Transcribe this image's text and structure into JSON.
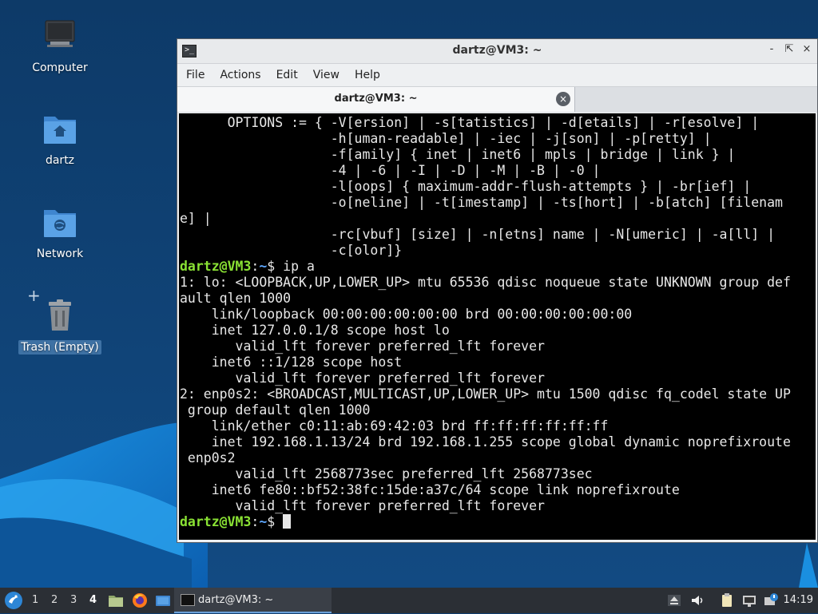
{
  "desktop": {
    "icons": [
      {
        "label": "Computer",
        "icon": "computer-icon"
      },
      {
        "label": "dartz",
        "icon": "home-folder-icon"
      },
      {
        "label": "Network",
        "icon": "network-folder-icon"
      },
      {
        "label": "Trash (Empty)",
        "icon": "trash-icon"
      }
    ],
    "plus": "+"
  },
  "window": {
    "title": "dartz@VM3: ~",
    "controls": {
      "minimize": "-",
      "restore": "⇱",
      "close": "×"
    },
    "menu": [
      "File",
      "Actions",
      "Edit",
      "View",
      "Help"
    ],
    "tab": {
      "label": "dartz@VM3: ~",
      "close": "×"
    }
  },
  "terminal": {
    "prompt_user": "dartz@VM3",
    "prompt_sep": ":",
    "prompt_path": "~",
    "prompt_sym": "$ ",
    "block1": "      OPTIONS := { -V[ersion] | -s[tatistics] | -d[etails] | -r[esolve] |\n                   -h[uman-readable] | -iec | -j[son] | -p[retty] |\n                   -f[amily] { inet | inet6 | mpls | bridge | link } |\n                   -4 | -6 | -I | -D | -M | -B | -0 |\n                   -l[oops] { maximum-addr-flush-attempts } | -br[ief] |\n                   -o[neline] | -t[imestamp] | -ts[hort] | -b[atch] [filenam\ne] |\n                   -rc[vbuf] [size] | -n[etns] name | -N[umeric] | -a[ll] |\n                   -c[olor]}",
    "command": "ip a",
    "block2": "1: lo: <LOOPBACK,UP,LOWER_UP> mtu 65536 qdisc noqueue state UNKNOWN group def\nault qlen 1000\n    link/loopback 00:00:00:00:00:00 brd 00:00:00:00:00:00\n    inet 127.0.0.1/8 scope host lo\n       valid_lft forever preferred_lft forever\n    inet6 ::1/128 scope host\n       valid_lft forever preferred_lft forever\n2: enp0s2: <BROADCAST,MULTICAST,UP,LOWER_UP> mtu 1500 qdisc fq_codel state UP\n group default qlen 1000\n    link/ether c0:11:ab:69:42:03 brd ff:ff:ff:ff:ff:ff\n    inet 192.168.1.13/24 brd 192.168.1.255 scope global dynamic noprefixroute\n enp0s2\n       valid_lft 2568773sec preferred_lft 2568773sec\n    inet6 fe80::bf52:38fc:15de:a37c/64 scope link noprefixroute\n       valid_lft forever preferred_lft forever"
  },
  "taskbar": {
    "workspaces": [
      "1",
      "2",
      "3",
      "4"
    ],
    "active_workspace": "4",
    "quicklaunch": [
      "files-icon",
      "firefox-icon",
      "show-desktop-icon"
    ],
    "task_label": "dartz@VM3: ~",
    "tray": [
      "eject-icon",
      "volume-icon",
      "clipboard-icon",
      "network-icon",
      "update-icon"
    ],
    "clock": "14:19"
  },
  "colors": {
    "prompt_user": "#8ae234",
    "prompt_path": "#5fa8ff",
    "desktop_bg": "#0e3d6e",
    "accent": "#2d86d6"
  }
}
